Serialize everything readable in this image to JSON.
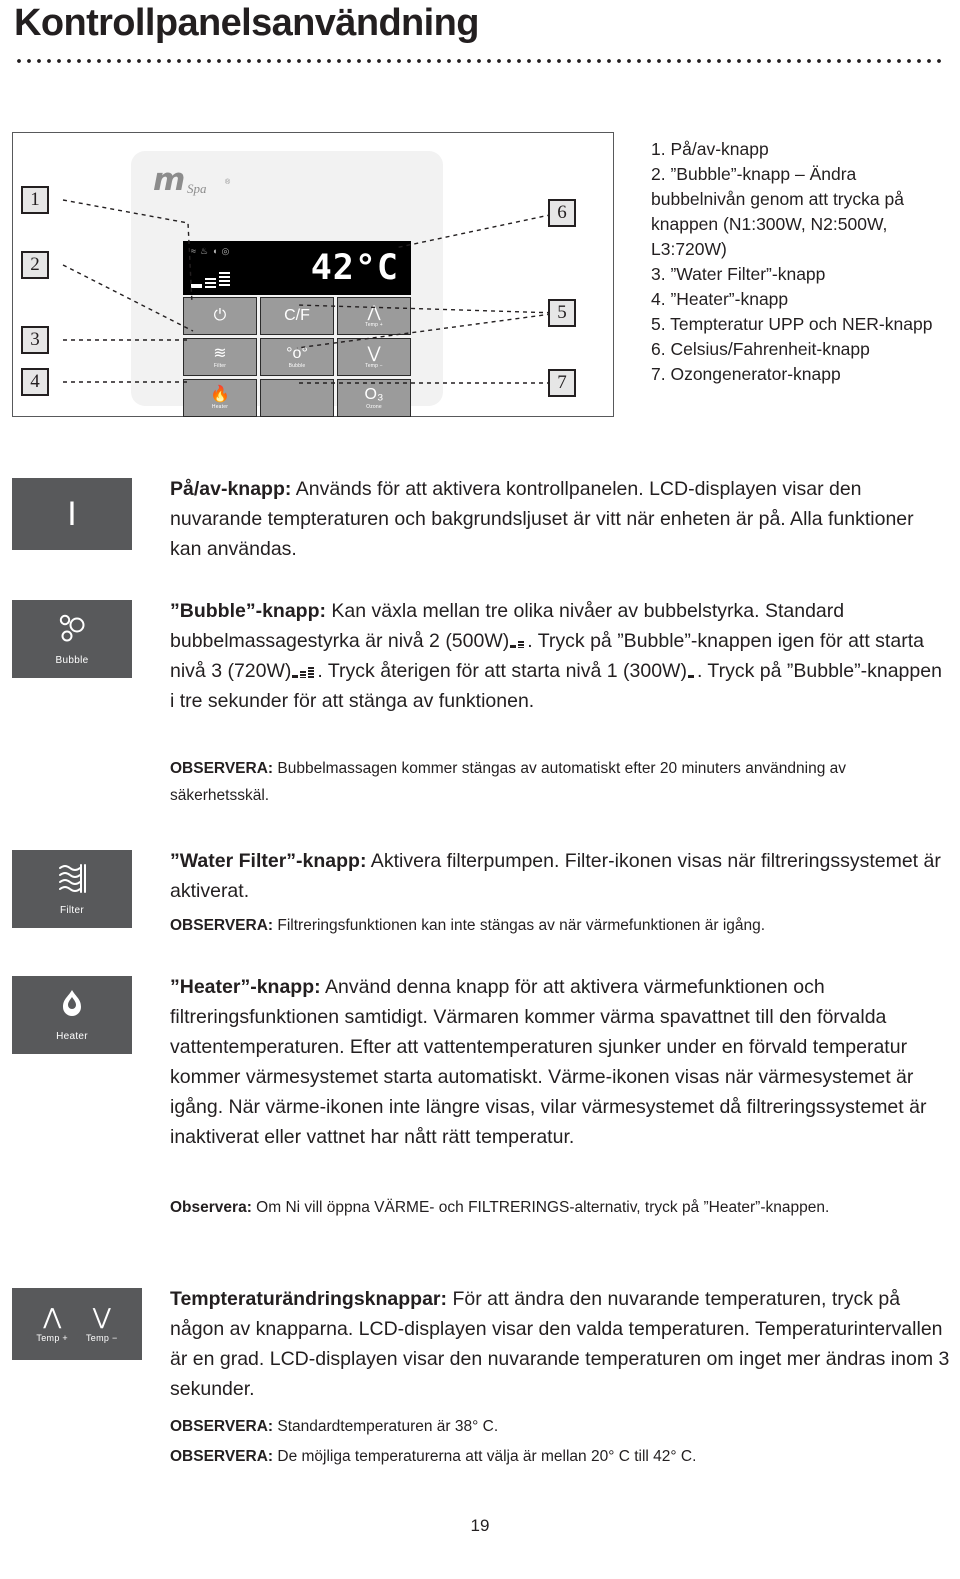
{
  "page": {
    "title": "Kontrollpanelsanvändning",
    "number": "19"
  },
  "diagram": {
    "logo": {
      "m": "m",
      "spa": "Spa",
      "reg": "®"
    },
    "lcd": {
      "temperature": "42°C",
      "status_icons": [
        "filter-icon",
        "heater-icon",
        "bubble-icon",
        "ozone-icon"
      ],
      "bubble_level_bars": 3
    },
    "buttons": [
      {
        "name": "power-button",
        "glyph": "⏻",
        "sub": ""
      },
      {
        "name": "celsius-fahrenheit-button",
        "glyph": "C/F",
        "sub": ""
      },
      {
        "name": "temp-up-button",
        "glyph": "⋀",
        "sub": "Temp +"
      },
      {
        "name": "filter-button",
        "glyph": "≋",
        "sub": "Filter"
      },
      {
        "name": "bubble-button",
        "glyph": "°o°",
        "sub": "Bubble"
      },
      {
        "name": "temp-down-button",
        "glyph": "⋁",
        "sub": "Temp −"
      },
      {
        "name": "heater-button",
        "glyph": "🔥",
        "sub": "Heater"
      },
      {
        "name": "blank-button",
        "glyph": "",
        "sub": ""
      },
      {
        "name": "ozone-button",
        "glyph": "O₃",
        "sub": "Ozone"
      }
    ],
    "callouts": [
      "1",
      "2",
      "3",
      "4",
      "5",
      "6",
      "7"
    ]
  },
  "legend": {
    "items": [
      "1. På/av-knapp",
      "2. ”Bubble”-knapp – Ändra bubbelnivån genom att trycka på knappen (N1:300W, N2:500W, L3:720W)",
      "3. ”Water Filter”-knapp",
      "4. ”Heater”-knapp",
      "5. Tempteratur UPP och NER-knapp",
      "6. Celsius/Fahrenheit-knapp",
      "7. Ozongenerator-knapp"
    ]
  },
  "sections": {
    "power": {
      "icon_caption": "",
      "heading": "På/av-knapp:",
      "body": " Används för att aktivera kontrollpanelen. LCD-displayen visar den nuvarande tempteraturen och bakgrundsljuset är vitt när enheten är på. Alla funktioner kan användas."
    },
    "bubble": {
      "icon_caption": "Bubble",
      "heading": "”Bubble”-knapp:",
      "body_1": " Kan växla mellan tre olika nivåer av bubbelstyrka. Standard bubbelmassagestyrka är nivå 2 (500W)",
      "body_2": ". Tryck på ”Bubble”-knappen igen för att starta nivå 3 (720W)",
      "body_3": ". Tryck återigen för att starta nivå 1 (300W)",
      "body_4": ". Tryck på ”Bubble”-knappen i tre sekunder för att stänga av funktionen.",
      "note_label": "OBSERVERA:",
      "note_text": " Bubbelmassagen kommer stängas av automatiskt efter 20 minuters användning av säkerhetsskäl."
    },
    "filter": {
      "icon_caption": "Filter",
      "heading": "”Water Filter”-knapp:",
      "body": " Aktivera filterpumpen. Filter-ikonen visas när filtreringssystemet är aktiverat.",
      "note_label": "OBSERVERA:",
      "note_text": " Filtreringsfunktionen kan inte stängas av när värmefunktionen är igång."
    },
    "heater": {
      "icon_caption": "Heater",
      "heading": "”Heater”-knapp:",
      "body": "  Använd denna knapp för att aktivera värmefunktionen och filtreringsfunktionen samtidigt. Värmaren kommer värma spavattnet till den förvalda vattentemperaturen. Efter att vattentemperaturen sjunker under en förvald temperatur kommer värmesystemet starta automatiskt. Värme-ikonen visas när värmesystemet är igång. När värme-ikonen inte längre visas, vilar värmesystemet då filtreringssystemet är inaktiverat eller vattnet har nått rätt temperatur.",
      "note_label": "Observera:",
      "note_text": " Om Ni vill öppna VÄRME- och FILTRERINGS-alternativ, tryck på ”Heater”-knappen."
    },
    "temperature": {
      "icon_up_caption": "Temp +",
      "icon_down_caption": "Temp −",
      "heading": "Tempteraturändringsknappar:",
      "body": "  För att ändra den nuvarande temperaturen, tryck på någon av knapparna. LCD-displayen visar den valda temperaturen. Temperaturintervallen är en grad. LCD-displayen visar den nuvarande temperaturen om inget mer ändras inom 3 sekunder.",
      "note_1_label": "OBSERVERA:",
      "note_1_text": " Standardtemperaturen är 38° C.",
      "note_2_label": "OBSERVERA:",
      "note_2_text": " De möjliga temperaturerna att välja är mellan 20° C till 42° C."
    }
  },
  "colors": {
    "ink": "#231f20",
    "icon_box": "#58595b",
    "panel_button": "#9b9b9b",
    "panel_body": "#f2f2f2"
  }
}
